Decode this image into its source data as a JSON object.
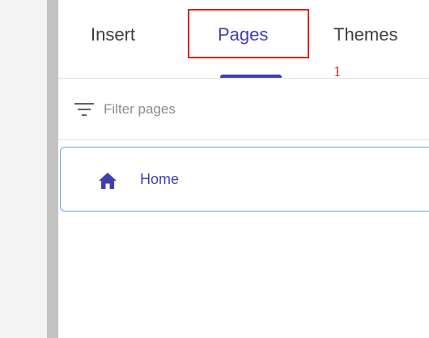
{
  "tabs": {
    "insert_label": "Insert",
    "pages_label": "Pages",
    "themes_label": "Themes",
    "active": "Pages"
  },
  "annotation": {
    "number": "1"
  },
  "filter": {
    "placeholder": "Filter pages",
    "value": "",
    "icon": "filter-icon"
  },
  "pages": [
    {
      "label": "Home",
      "icon": "home-icon"
    }
  ],
  "colors": {
    "accent": "#3f3fb3",
    "annotation": "#d9261c",
    "selection_border": "#5fa8ee"
  }
}
